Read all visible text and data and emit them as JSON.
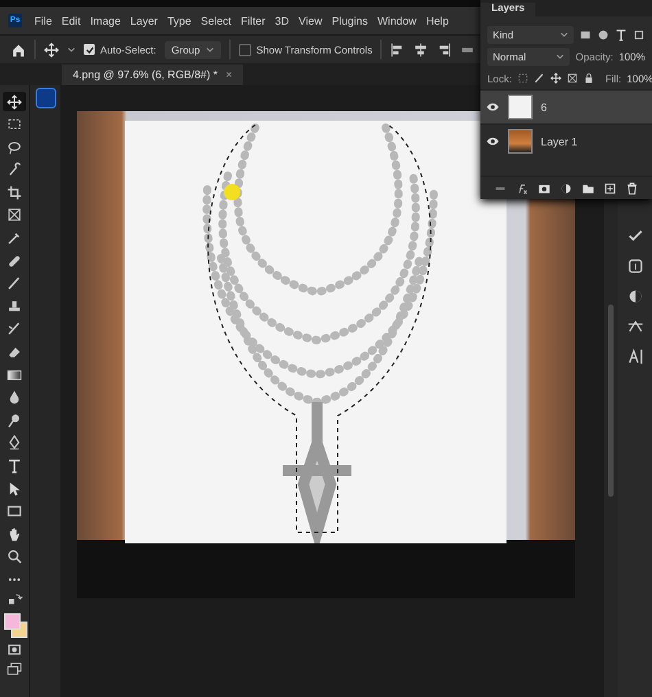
{
  "app_logo": "Ps",
  "menu": [
    "File",
    "Edit",
    "Image",
    "Layer",
    "Type",
    "Select",
    "Filter",
    "3D",
    "View",
    "Plugins",
    "Window",
    "Help"
  ],
  "options_bar": {
    "auto_select": {
      "label": "Auto-Select:",
      "checked": true
    },
    "target": "Group",
    "show_transform": {
      "label": "Show Transform Controls",
      "checked": false
    }
  },
  "document_tab": {
    "title": "4.png @ 97.6% (6, RGB/8#) *",
    "close": "×"
  },
  "tools": [
    {
      "kind": "move",
      "selected": true
    },
    {
      "kind": "marquee",
      "selected": false
    },
    {
      "kind": "lasso",
      "selected": false
    },
    {
      "kind": "quick-select",
      "selected": false
    },
    {
      "kind": "crop",
      "selected": false
    },
    {
      "kind": "frame",
      "selected": false
    },
    {
      "kind": "eyedropper",
      "selected": false
    },
    {
      "kind": "healing",
      "selected": false
    },
    {
      "kind": "brush",
      "selected": false
    },
    {
      "kind": "stamp",
      "selected": false
    },
    {
      "kind": "history",
      "selected": false
    },
    {
      "kind": "eraser",
      "selected": false
    },
    {
      "kind": "gradient",
      "selected": false
    },
    {
      "kind": "blur",
      "selected": false
    },
    {
      "kind": "dodge",
      "selected": false
    },
    {
      "kind": "pen",
      "selected": false
    },
    {
      "kind": "type",
      "selected": false
    },
    {
      "kind": "path",
      "selected": false
    },
    {
      "kind": "rectangle",
      "selected": false
    },
    {
      "kind": "hand",
      "selected": false
    },
    {
      "kind": "zoom",
      "selected": false
    },
    {
      "kind": "more",
      "selected": false
    }
  ],
  "swatches": [
    {
      "kind": "foreground",
      "color": "#f6b8da"
    },
    {
      "kind": "background",
      "color": "#f2d48e"
    }
  ],
  "layers_panel": {
    "title": "Layers",
    "filter": "Kind",
    "blend_mode": "Normal",
    "opacity_label": "Opacity:",
    "opacity": "100%",
    "lock_label": "Lock:",
    "fill_label": "Fill:",
    "fill": "100%",
    "layers": [
      {
        "name": "6",
        "kind": "cutout",
        "visible": true,
        "selected": true
      },
      {
        "name": "Layer 1",
        "kind": "photo",
        "visible": true,
        "selected": false
      }
    ]
  }
}
